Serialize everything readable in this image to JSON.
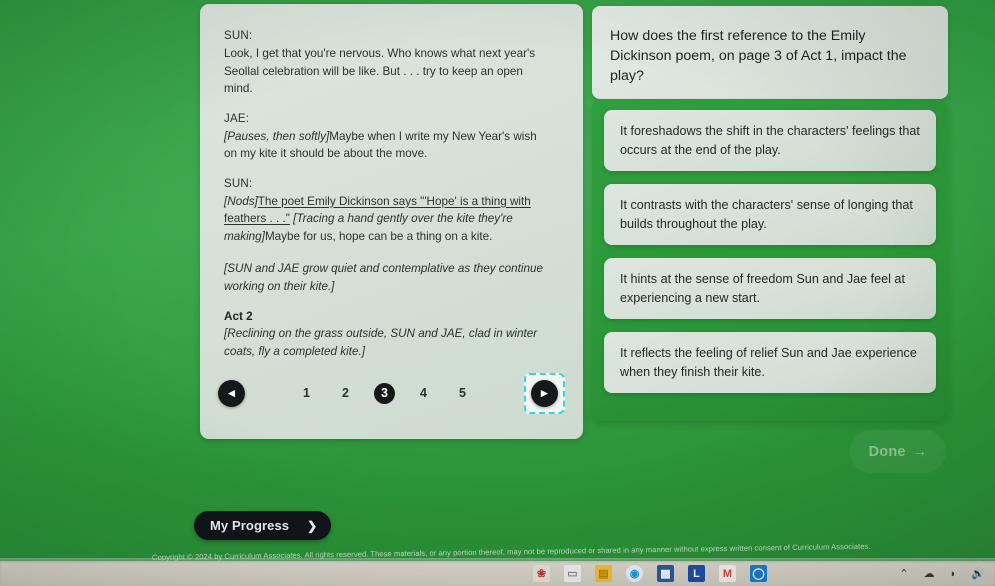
{
  "theme": {
    "background_green": "#2f9e3f",
    "panel_light": "#dbe5dc",
    "dark_button": "#15191a",
    "focus_cyan": "#3fd0e8"
  },
  "passage": {
    "blocks": [
      {
        "speaker": "SUN:",
        "lines": [
          "Look, I get that you're nervous. Who knows what next year's",
          "Seollal celebration will be like. But . . . try to keep an open",
          "mind."
        ]
      },
      {
        "speaker": "JAE:",
        "stage_open": "[Pauses, then softly]",
        "lines": [
          "Maybe when I write my New Year's wish",
          "on my kite it should be about the move."
        ]
      },
      {
        "speaker": "SUN:",
        "stage_open": "[Nods]",
        "quote": "The poet Emily Dickinson says \"'Hope' is a thing with feathers . . .\"",
        "stage_mid": "[Tracing a hand gently over the kite they're making]",
        "lines": [
          "Maybe for us, hope can be a thing on a kite."
        ]
      }
    ],
    "closing_stage": "[SUN and JAE grow quiet and contemplative as they continue working on their kite.]",
    "act_heading": "Act 2",
    "act_stage": "[Reclining on the grass outside, SUN and JAE, clad in winter coats, fly a completed kite.]"
  },
  "pagination": {
    "prev_icon": "◄",
    "next_icon": "►",
    "pages": [
      "1",
      "2",
      "3",
      "4",
      "5"
    ],
    "current_page": "3"
  },
  "question": {
    "prompt": "How does the first reference to the Emily Dickinson poem, on page 3 of Act 1, impact the play?",
    "choices": [
      "It foreshadows the shift in the characters' feelings that occurs at the end of the play.",
      "It contrasts with the characters' sense of longing that builds throughout the play.",
      "It hints at the sense of freedom Sun and Jae feel at experiencing a new start.",
      "It reflects the feeling of relief Sun and Jae experience when they finish their kite."
    ]
  },
  "actions": {
    "done_label": "Done",
    "done_arrow": "→",
    "progress_label": "My Progress",
    "progress_chevron": "❯"
  },
  "footer": {
    "copyright": "Copyright © 2024 by Curriculum Associates. All rights reserved. These materials, or any portion thereof, may not be reproduced or shared in any manner without express written consent of Curriculum Associates."
  },
  "taskbar": {
    "apps": [
      {
        "name": "photos-icon",
        "glyph": "",
        "color": "#e8e4da"
      },
      {
        "name": "file-explorer-icon",
        "glyph": "",
        "color": "#f3c13a"
      },
      {
        "name": "edge-browser-icon",
        "glyph": "",
        "color": "#1b9ee6"
      },
      {
        "name": "store-icon",
        "glyph": "",
        "color": "#2a5e9e"
      },
      {
        "name": "lastpass-icon",
        "glyph": "L",
        "color": "#1f4fa8"
      },
      {
        "name": "gmail-icon",
        "glyph": "M",
        "color": "#d24a3c"
      },
      {
        "name": "cortana-icon",
        "glyph": "◯",
        "color": "#1b7fd4"
      }
    ],
    "tray": [
      {
        "name": "show-hidden-icons-chevron",
        "glyph": "⌃"
      },
      {
        "name": "onedrive-icon",
        "glyph": "☁"
      },
      {
        "name": "wifi-icon",
        "glyph": "📶"
      },
      {
        "name": "volume-icon",
        "glyph": "🔊"
      }
    ]
  }
}
